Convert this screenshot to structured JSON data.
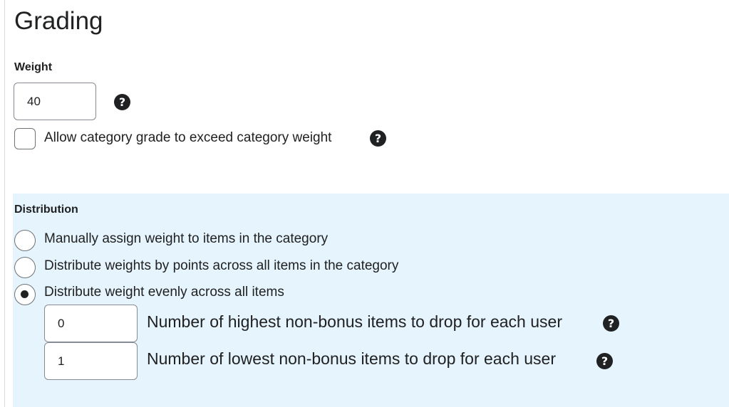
{
  "page": {
    "title": "Grading"
  },
  "weight": {
    "label": "Weight",
    "value": "40",
    "help_icon": "help-circle-icon"
  },
  "exceed_option": {
    "label": "Allow category grade to exceed category weight",
    "checked": false,
    "help_icon": "help-circle-icon"
  },
  "distribution": {
    "label": "Distribution",
    "options": [
      {
        "label": "Manually assign weight to items in the category",
        "selected": false
      },
      {
        "label": "Distribute weights by points across all items in the category",
        "selected": false
      },
      {
        "label": "Distribute weight evenly across all items",
        "selected": true
      }
    ],
    "drop_highest": {
      "value": "0",
      "label": "Number of highest non-bonus items to drop for each user",
      "help_icon": "help-circle-icon"
    },
    "drop_lowest": {
      "value": "1",
      "label": "Number of lowest non-bonus items to drop for each user",
      "help_icon": "help-circle-icon"
    },
    "panel_color": "#e6f4fd"
  },
  "colors": {
    "text": "#202122",
    "border": "#868a92"
  }
}
